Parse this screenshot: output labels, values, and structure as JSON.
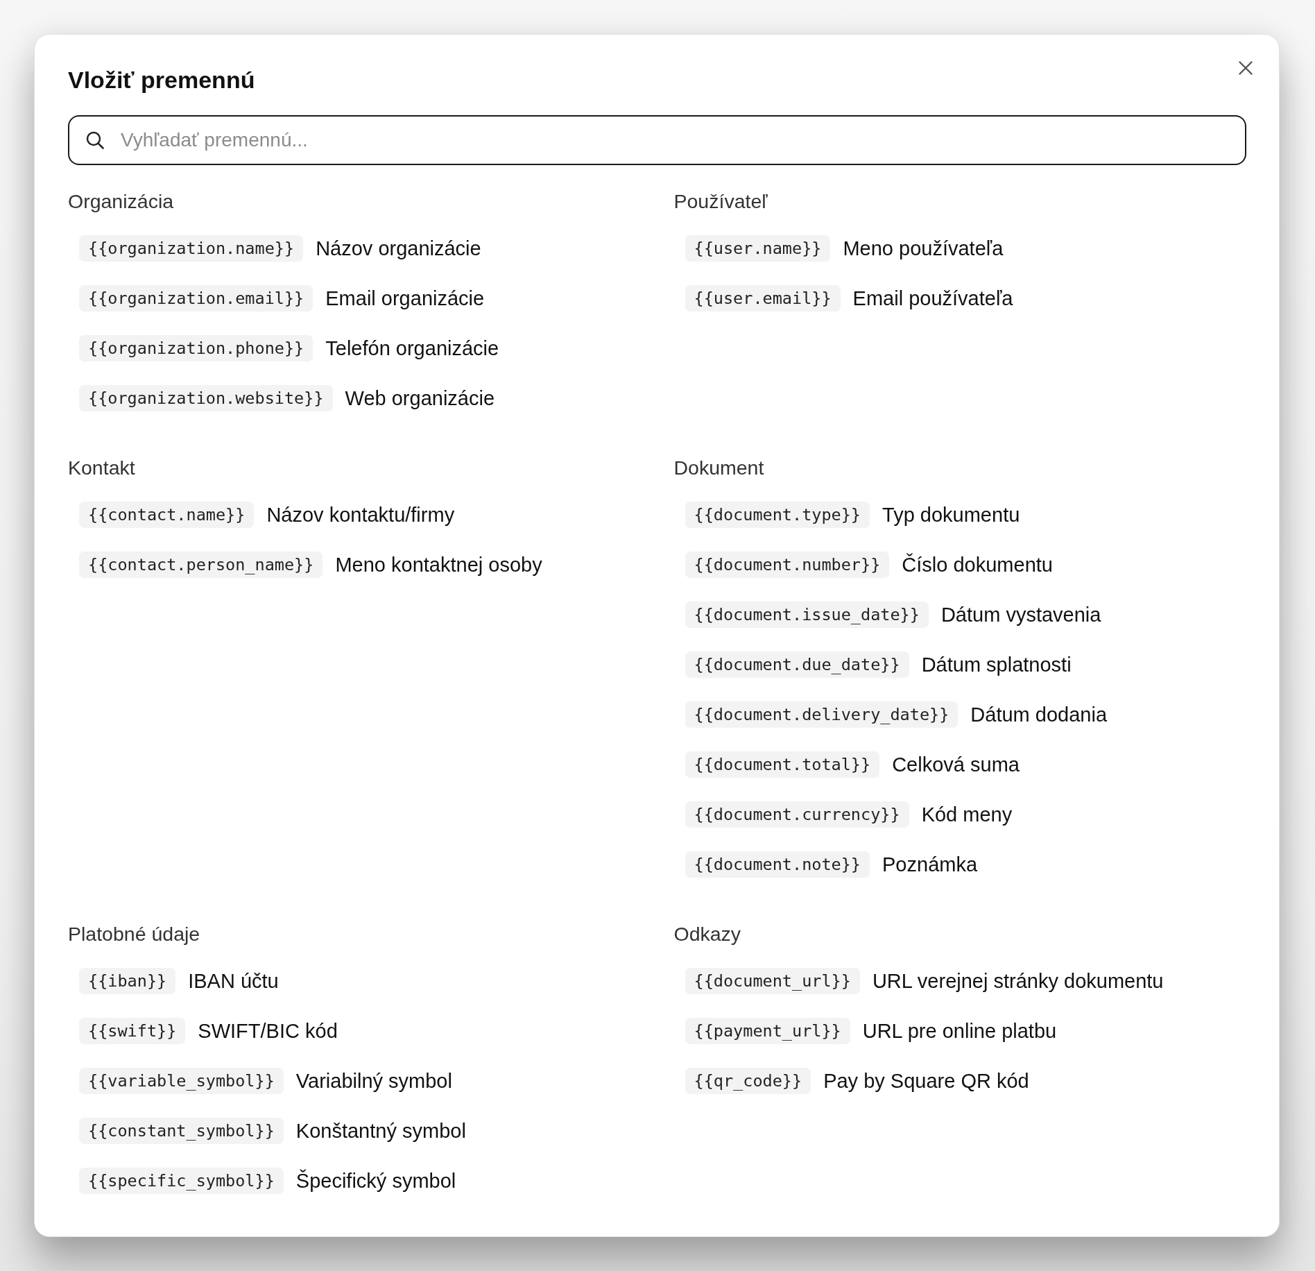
{
  "dialog": {
    "title": "Vložiť premennú"
  },
  "search": {
    "placeholder": "Vyhľadať premennú..."
  },
  "sections": [
    {
      "title": "Organizácia",
      "variables": [
        {
          "code": "{{organization.name}}",
          "description": "Názov organizácie"
        },
        {
          "code": "{{organization.email}}",
          "description": "Email organizácie"
        },
        {
          "code": "{{organization.phone}}",
          "description": "Telefón organizácie"
        },
        {
          "code": "{{organization.website}}",
          "description": "Web organizácie"
        }
      ]
    },
    {
      "title": "Používateľ",
      "variables": [
        {
          "code": "{{user.name}}",
          "description": "Meno používateľa"
        },
        {
          "code": "{{user.email}}",
          "description": "Email používateľa"
        }
      ]
    },
    {
      "title": "Kontakt",
      "variables": [
        {
          "code": "{{contact.name}}",
          "description": "Názov kontaktu/firmy"
        },
        {
          "code": "{{contact.person_name}}",
          "description": "Meno kontaktnej osoby"
        }
      ]
    },
    {
      "title": "Dokument",
      "variables": [
        {
          "code": "{{document.type}}",
          "description": "Typ dokumentu"
        },
        {
          "code": "{{document.number}}",
          "description": "Číslo dokumentu"
        },
        {
          "code": "{{document.issue_date}}",
          "description": "Dátum vystavenia"
        },
        {
          "code": "{{document.due_date}}",
          "description": "Dátum splatnosti"
        },
        {
          "code": "{{document.delivery_date}}",
          "description": "Dátum dodania"
        },
        {
          "code": "{{document.total}}",
          "description": "Celková suma"
        },
        {
          "code": "{{document.currency}}",
          "description": "Kód meny"
        },
        {
          "code": "{{document.note}}",
          "description": "Poznámka"
        }
      ]
    },
    {
      "title": "Platobné údaje",
      "variables": [
        {
          "code": "{{iban}}",
          "description": "IBAN účtu"
        },
        {
          "code": "{{swift}}",
          "description": "SWIFT/BIC kód"
        },
        {
          "code": "{{variable_symbol}}",
          "description": "Variabilný symbol"
        },
        {
          "code": "{{constant_symbol}}",
          "description": "Konštantný symbol"
        },
        {
          "code": "{{specific_symbol}}",
          "description": "Špecifický symbol"
        }
      ]
    },
    {
      "title": "Odkazy",
      "variables": [
        {
          "code": "{{document_url}}",
          "description": "URL verejnej stránky dokumentu"
        },
        {
          "code": "{{payment_url}}",
          "description": "URL pre online platbu"
        },
        {
          "code": "{{qr_code}}",
          "description": "Pay by Square QR kód"
        }
      ]
    }
  ]
}
